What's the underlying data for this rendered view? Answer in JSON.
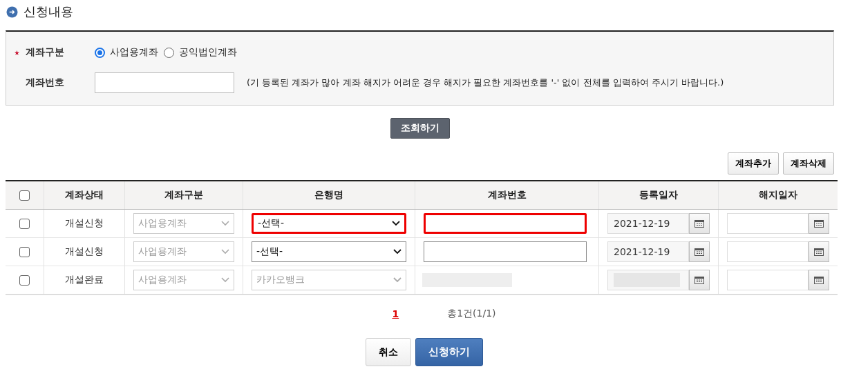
{
  "section_title": "신청내용",
  "form": {
    "type_label": "계좌구분",
    "required": true,
    "type_options": [
      {
        "label": "사업용계좌",
        "selected": true
      },
      {
        "label": "공익법인계좌",
        "selected": false
      }
    ],
    "account_label": "계좌번호",
    "hint": "(기 등록된 계좌가 많아 계좌 해지가 어려운 경우 해지가 필요한 계좌번호를 '-' 없이 전체를 입력하여 주시기 바랍니다.)"
  },
  "search_button": "조회하기",
  "table_buttons": [
    "계좌추가",
    "계좌삭제"
  ],
  "table": {
    "select_all_checked": false,
    "columns": [
      "계좌상태",
      "계좌구분",
      "은행명",
      "계좌번호",
      "등록일자",
      "해지일자"
    ],
    "rows": [
      {
        "checked": false,
        "status": "개설신청",
        "type": "사업용계좌",
        "bank": "-선택-",
        "bank_disabled": false,
        "account_redacted": false,
        "reg_date": "2021-12-19",
        "reg_date_redacted": false,
        "highlight": true
      },
      {
        "checked": false,
        "status": "개설신청",
        "type": "사업용계좌",
        "bank": "-선택-",
        "bank_disabled": false,
        "account_redacted": false,
        "reg_date": "2021-12-19",
        "reg_date_redacted": false,
        "highlight": false
      },
      {
        "checked": false,
        "status": "개설완료",
        "type": "사업용계좌",
        "bank": "카카오뱅크",
        "bank_disabled": true,
        "account_redacted": true,
        "reg_date_redacted": true,
        "highlight": false
      }
    ]
  },
  "pagination": {
    "pages": [
      {
        "label": "1",
        "selected": true
      }
    ],
    "total": "총1건(1/1)"
  },
  "buttons": [
    {
      "label": "취소",
      "kind": "secondary"
    },
    {
      "label": "신청하기",
      "kind": "primary"
    }
  ]
}
